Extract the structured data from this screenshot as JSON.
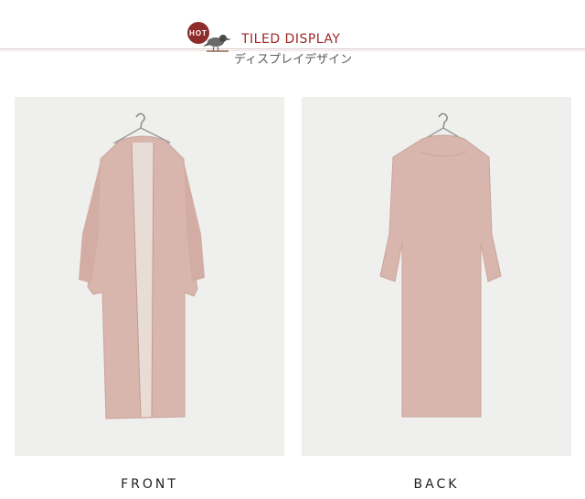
{
  "header": {
    "badge": "HOT",
    "title": "TILED DISPLAY",
    "subtitle": "ディスプレイデザイン"
  },
  "panels": [
    {
      "caption": "FRONT"
    },
    {
      "caption": "BACK"
    }
  ],
  "colors": {
    "accent": "#a02a2a",
    "garment": "#d9b6ad",
    "panel_bg": "#efefed"
  }
}
